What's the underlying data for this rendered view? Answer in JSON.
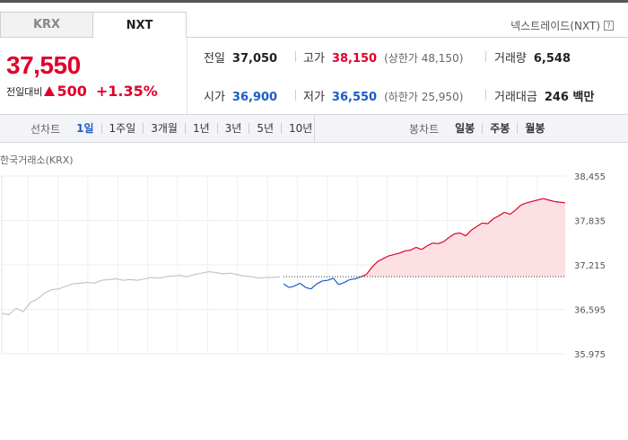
{
  "tabs": [
    {
      "label": "KRX",
      "active": false
    },
    {
      "label": "NXT",
      "active": true
    }
  ],
  "nxt_label": "넥스트레이드(NXT)",
  "help_icon": "?",
  "price": {
    "current": "37,550",
    "change_label": "전일대비",
    "change_icon": "up-triangle-icon",
    "change_value": "500",
    "change_pct": "+1.35%"
  },
  "stats": {
    "prev_close": {
      "label": "전일",
      "value": "37,050"
    },
    "high": {
      "label": "고가",
      "value": "38,150",
      "sub": "(상한가 48,150)"
    },
    "volume": {
      "label": "거래량",
      "value": "6,548"
    },
    "open": {
      "label": "시가",
      "value": "36,900"
    },
    "low": {
      "label": "저가",
      "value": "36,550",
      "sub": "(하한가 25,950)"
    },
    "amount": {
      "label": "거래대금",
      "value": "246 백만"
    }
  },
  "toolbar": {
    "line_label": "선차트",
    "line_periods": [
      "1일",
      "1주일",
      "3개월",
      "1년",
      "3년",
      "5년",
      "10년"
    ],
    "line_active": "1일",
    "candle_label": "봉차트",
    "candle_periods": [
      "일봉",
      "주봉",
      "월봉"
    ]
  },
  "colors": {
    "up": "#e0002a",
    "down": "#1a5cc8",
    "neutral": "#bbbbbb",
    "fill": "#fde0e3"
  },
  "chart_data": {
    "type": "line",
    "title": "한국거래소(KRX)",
    "baseline": 37050,
    "ylim": [
      35975,
      38455
    ],
    "yticks": [
      38455,
      37835,
      37215,
      36595,
      35975
    ],
    "ytick_labels": [
      "38,455",
      "37,835",
      "37,215",
      "36,595",
      "35,975"
    ],
    "series": [
      {
        "segment": "prior",
        "values": [
          36540,
          36520,
          36610,
          36560,
          36690,
          36740,
          36820,
          36870,
          36880,
          36920,
          36950,
          36960,
          36970,
          36960,
          37000,
          37010,
          37020,
          37000,
          37010,
          37000,
          37020,
          37040,
          37030,
          37050,
          37060,
          37070,
          37050,
          37080,
          37100,
          37120,
          37110,
          37090,
          37100,
          37080,
          37060,
          37050,
          37030,
          37040,
          37040,
          37050
        ]
      },
      {
        "segment": "current",
        "values": [
          36950,
          36900,
          36920,
          36960,
          36900,
          36880,
          36950,
          36990,
          37000,
          37030,
          36940,
          36970,
          37010,
          37020,
          37050,
          37080,
          37180,
          37260,
          37300,
          37340,
          37360,
          37380,
          37410,
          37420,
          37460,
          37430,
          37480,
          37520,
          37510,
          37540,
          37600,
          37650,
          37660,
          37620,
          37700,
          37750,
          37800,
          37790,
          37860,
          37900,
          37950,
          37920,
          37980,
          38050,
          38080,
          38100,
          38120,
          38140,
          38120,
          38100,
          38090,
          38080
        ]
      }
    ]
  }
}
